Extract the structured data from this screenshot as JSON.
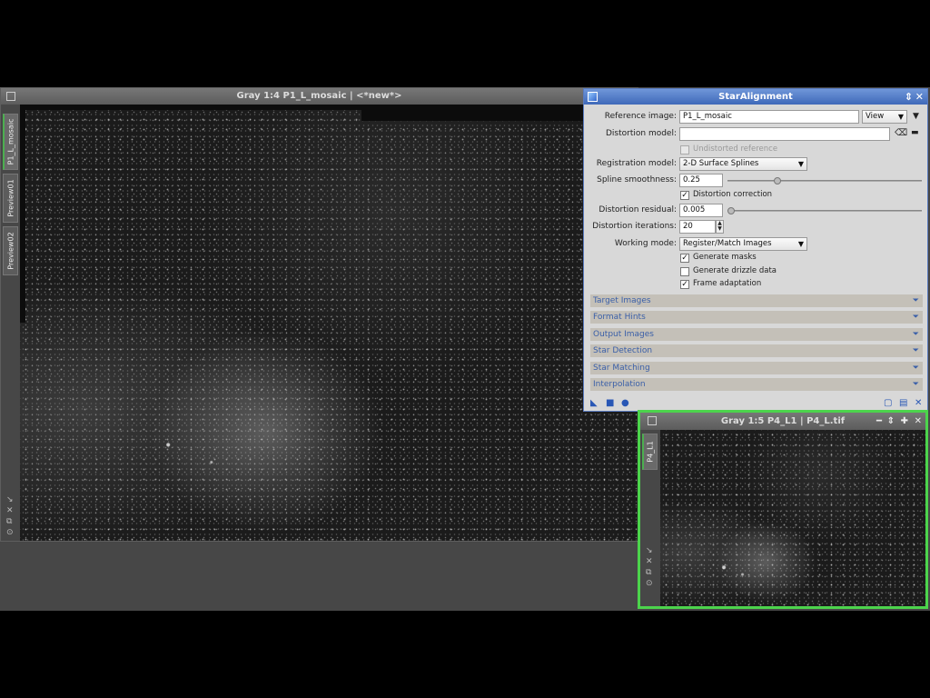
{
  "main_window": {
    "title": "Gray 1:4 P1_L_mosaic | <*new*>",
    "tabs": [
      "P1_L_mosaic",
      "Preview01",
      "Preview02"
    ]
  },
  "panel": {
    "title": "StarAlignment",
    "reference_image": {
      "label": "Reference image:",
      "value": "P1_L_mosaic",
      "view_button": "View"
    },
    "distortion_model": {
      "label": "Distortion model:",
      "value": ""
    },
    "undistorted_reference": {
      "label": "Undistorted reference",
      "checked": false,
      "enabled": false
    },
    "registration_model": {
      "label": "Registration model:",
      "value": "2-D Surface Splines"
    },
    "spline_smoothness": {
      "label": "Spline smoothness:",
      "value": "0.25"
    },
    "distortion_correction": {
      "label": "Distortion correction",
      "checked": true
    },
    "distortion_residual": {
      "label": "Distortion residual:",
      "value": "0.005"
    },
    "distortion_iterations": {
      "label": "Distortion iterations:",
      "value": "20"
    },
    "working_mode": {
      "label": "Working mode:",
      "value": "Register/Match Images"
    },
    "generate_masks": {
      "label": "Generate masks",
      "checked": true
    },
    "generate_drizzle": {
      "label": "Generate drizzle data",
      "checked": false
    },
    "frame_adaptation": {
      "label": "Frame adaptation",
      "checked": true
    },
    "sections": [
      "Target Images",
      "Format Hints",
      "Output Images",
      "Star Detection",
      "Star Matching",
      "Interpolation"
    ]
  },
  "second_window": {
    "title": "Gray 1:5 P4_L1 | P4_L.tif",
    "tab": "P4_L1"
  },
  "colors": {
    "highlight_border": "#4cd44c",
    "panel_title": "#3f69b9",
    "section_text": "#3a5fa8"
  }
}
